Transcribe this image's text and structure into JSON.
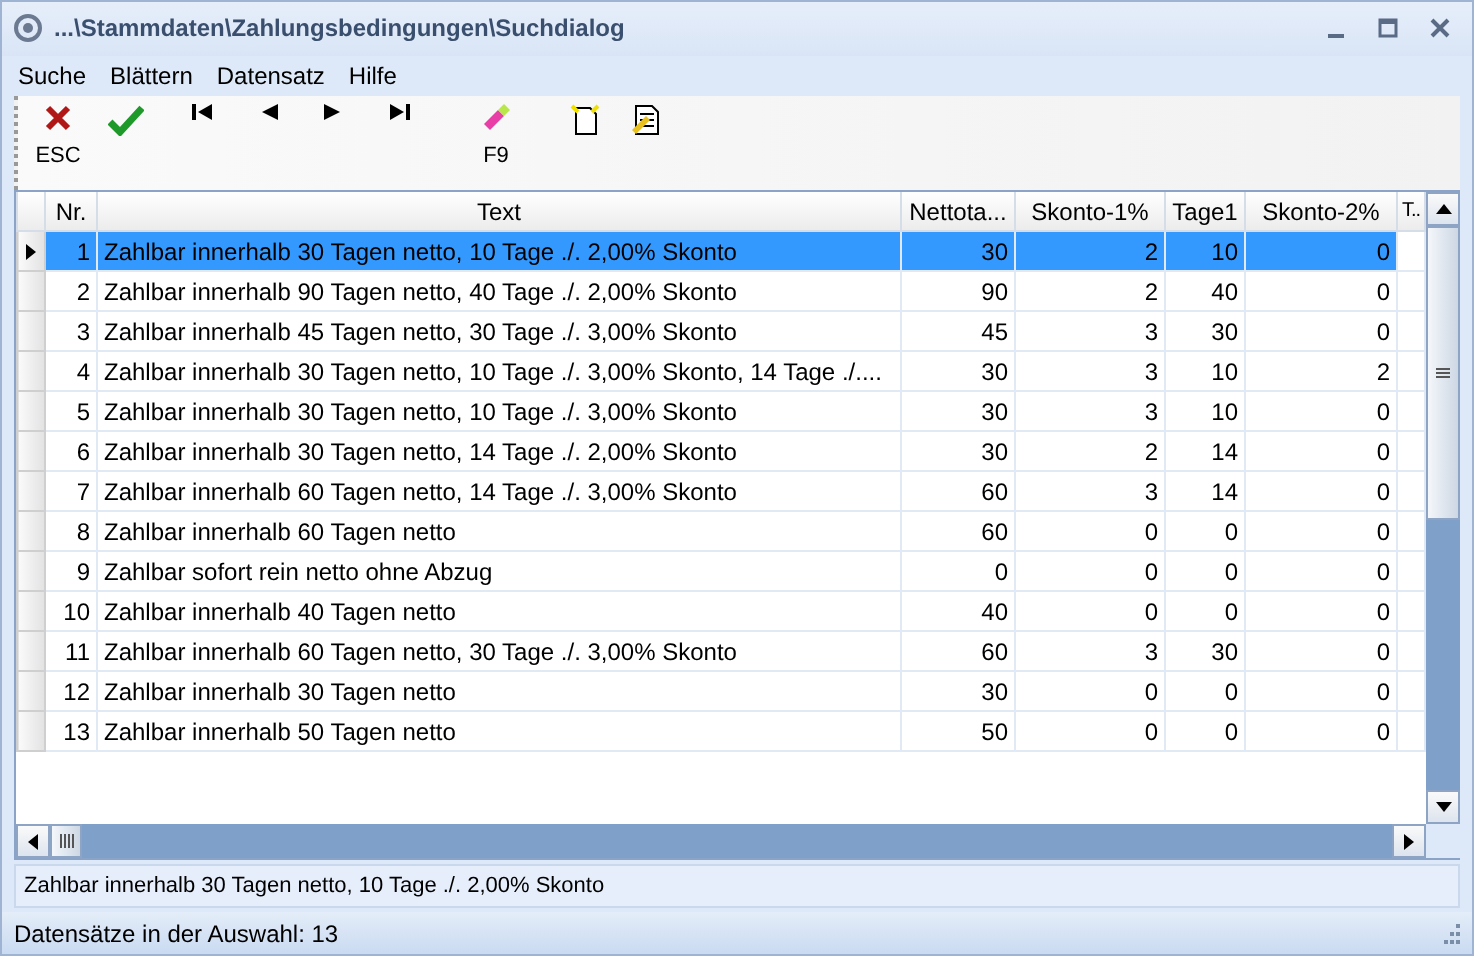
{
  "window": {
    "title": "...\\Stammdaten\\Zahlungsbedingungen\\Suchdialog"
  },
  "menu": [
    "Suche",
    "Blättern",
    "Datensatz",
    "Hilfe"
  ],
  "toolbar": [
    {
      "kind": "cancel",
      "label": "ESC"
    },
    {
      "kind": "ok"
    },
    {
      "kind": "first"
    },
    {
      "kind": "prev"
    },
    {
      "kind": "next"
    },
    {
      "kind": "last"
    },
    {
      "kind": "eraser",
      "label": "F9"
    },
    {
      "kind": "new"
    },
    {
      "kind": "edit"
    }
  ],
  "table": {
    "columns": [
      "Nr.",
      "Text",
      "Nettota...",
      "Skonto-1%",
      "Tage1",
      "Skonto-2%",
      "T.."
    ],
    "rows": [
      {
        "selected": true,
        "cells": [
          "1",
          "Zahlbar innerhalb 30 Tagen netto, 10 Tage ./. 2,00% Skonto",
          "30",
          "2",
          "10",
          "0"
        ]
      },
      {
        "selected": false,
        "cells": [
          "2",
          "Zahlbar innerhalb 90 Tagen netto, 40 Tage ./. 2,00% Skonto",
          "90",
          "2",
          "40",
          "0"
        ]
      },
      {
        "selected": false,
        "cells": [
          "3",
          "Zahlbar innerhalb 45 Tagen netto, 30 Tage ./. 3,00% Skonto",
          "45",
          "3",
          "30",
          "0"
        ]
      },
      {
        "selected": false,
        "cells": [
          "4",
          "Zahlbar innerhalb 30 Tagen netto, 10 Tage ./. 3,00% Skonto, 14 Tage ./....",
          "30",
          "3",
          "10",
          "2"
        ]
      },
      {
        "selected": false,
        "cells": [
          "5",
          "Zahlbar innerhalb 30 Tagen netto, 10 Tage ./. 3,00% Skonto",
          "30",
          "3",
          "10",
          "0"
        ]
      },
      {
        "selected": false,
        "cells": [
          "6",
          "Zahlbar innerhalb 30 Tagen netto, 14 Tage ./. 2,00% Skonto",
          "30",
          "2",
          "14",
          "0"
        ]
      },
      {
        "selected": false,
        "cells": [
          "7",
          "Zahlbar innerhalb 60 Tagen netto, 14 Tage ./. 3,00% Skonto",
          "60",
          "3",
          "14",
          "0"
        ]
      },
      {
        "selected": false,
        "cells": [
          "8",
          "Zahlbar innerhalb 60 Tagen netto",
          "60",
          "0",
          "0",
          "0"
        ]
      },
      {
        "selected": false,
        "cells": [
          "9",
          "Zahlbar sofort rein netto ohne Abzug",
          "0",
          "0",
          "0",
          "0"
        ]
      },
      {
        "selected": false,
        "cells": [
          "10",
          "Zahlbar innerhalb 40 Tagen netto",
          "40",
          "0",
          "0",
          "0"
        ]
      },
      {
        "selected": false,
        "cells": [
          "11",
          "Zahlbar innerhalb 60 Tagen netto, 30 Tage ./. 3,00% Skonto",
          "60",
          "3",
          "30",
          "0"
        ]
      },
      {
        "selected": false,
        "cells": [
          "12",
          "Zahlbar innerhalb 30 Tagen netto",
          "30",
          "0",
          "0",
          "0"
        ]
      },
      {
        "selected": false,
        "cells": [
          "13",
          "Zahlbar innerhalb 50 Tagen netto",
          "50",
          "0",
          "0",
          "0"
        ]
      }
    ]
  },
  "memo": "Zahlbar innerhalb 30 Tagen netto, 10 Tage ./. 2,00% Skonto",
  "status_bar": "Datensätze in der Auswahl: 13"
}
